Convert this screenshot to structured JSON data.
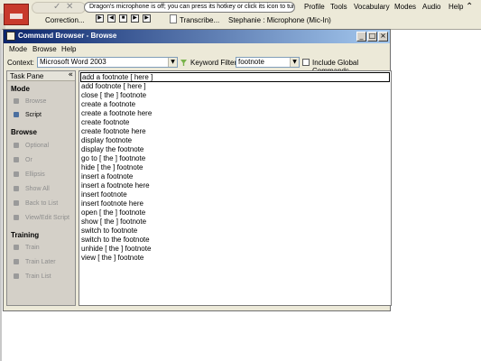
{
  "dragon_bar": {
    "message": "Dragon's microphone is off; you can press its hotkey or click its icon to tur...",
    "menu": [
      "Profile",
      "Tools",
      "Vocabulary",
      "Modes",
      "Audio",
      "Help"
    ],
    "correction": "Correction...",
    "transcribe": "Transcribe...",
    "mic_status": "Stephanie : Microphone (Mic-In)"
  },
  "window": {
    "title": "Command Browser - Browse",
    "menu": [
      "Mode",
      "Browse",
      "Help"
    ],
    "context_label": "Context:",
    "context_value": "Microsoft Word 2003",
    "keyword_filter_label": "Keyword Filter",
    "keyword_filter_value": "footnote",
    "include_global_label": "Include Global Commands"
  },
  "task_pane": {
    "title": "Task Pane",
    "sections": [
      {
        "title": "Mode",
        "items": [
          {
            "label": "Browse",
            "enabled": false
          },
          {
            "label": "Script",
            "enabled": true
          }
        ]
      },
      {
        "title": "Browse",
        "items": [
          {
            "label": "Optional",
            "enabled": false
          },
          {
            "label": "Or",
            "enabled": false
          },
          {
            "label": "Ellipsis",
            "enabled": false
          },
          {
            "label": "Show All",
            "enabled": false
          },
          {
            "label": "Back to List",
            "enabled": false
          },
          {
            "label": "View/Edit Script",
            "enabled": false
          }
        ]
      },
      {
        "title": "Training",
        "items": [
          {
            "label": "Train",
            "enabled": false
          },
          {
            "label": "Train Later",
            "enabled": false
          },
          {
            "label": "Train List",
            "enabled": false
          }
        ]
      }
    ]
  },
  "commands": [
    "add a footnote [ here ]",
    "add footnote [ here ]",
    "close [ the ] footnote",
    "create a footnote",
    "create a footnote here",
    "create footnote",
    "create footnote here",
    "display footnote",
    "display the footnote",
    "go to [ the ] footnote",
    "hide [ the ] footnote",
    "insert a footnote",
    "insert a footnote here",
    "insert footnote",
    "insert footnote here",
    "open [ the ] footnote",
    "show [ the ] footnote",
    "switch to footnote",
    "switch to the footnote",
    "unhide [ the ] footnote",
    "view [ the ] footnote"
  ],
  "icons": {
    "collapse": "chevron-up-icon",
    "pane_collapse": "double-chevron-left-icon",
    "filter": "filter-icon"
  }
}
